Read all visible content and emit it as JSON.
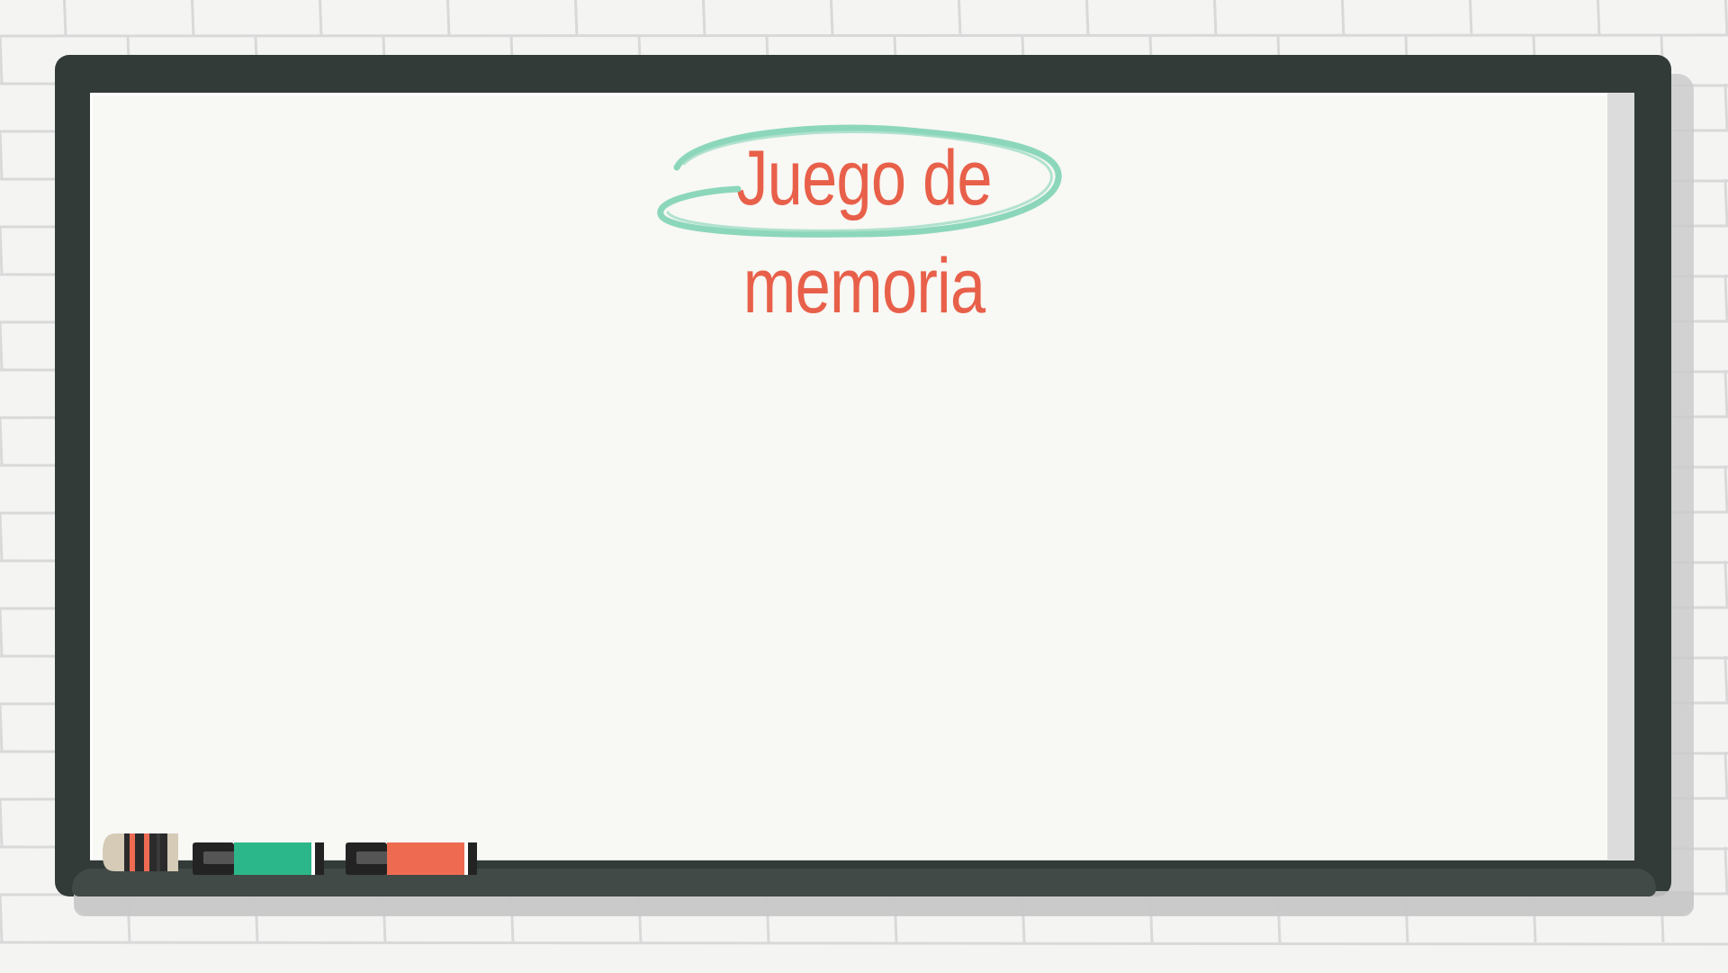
{
  "slide": {
    "title": "Juego de memoria"
  },
  "colors": {
    "wall": "#f4f4f3",
    "brick_lines": "#d9d9d9",
    "board_frame": "#323b38",
    "board_surface": "#f8f8f4",
    "title_text": "#e8604a",
    "title_circle": "#7fd3b6",
    "marker_green": "#2cb78a",
    "marker_orange": "#ee6b52",
    "eraser_body": "#d5cbb6"
  },
  "icons": [
    "eraser-icon",
    "green-marker-icon",
    "orange-marker-icon"
  ]
}
